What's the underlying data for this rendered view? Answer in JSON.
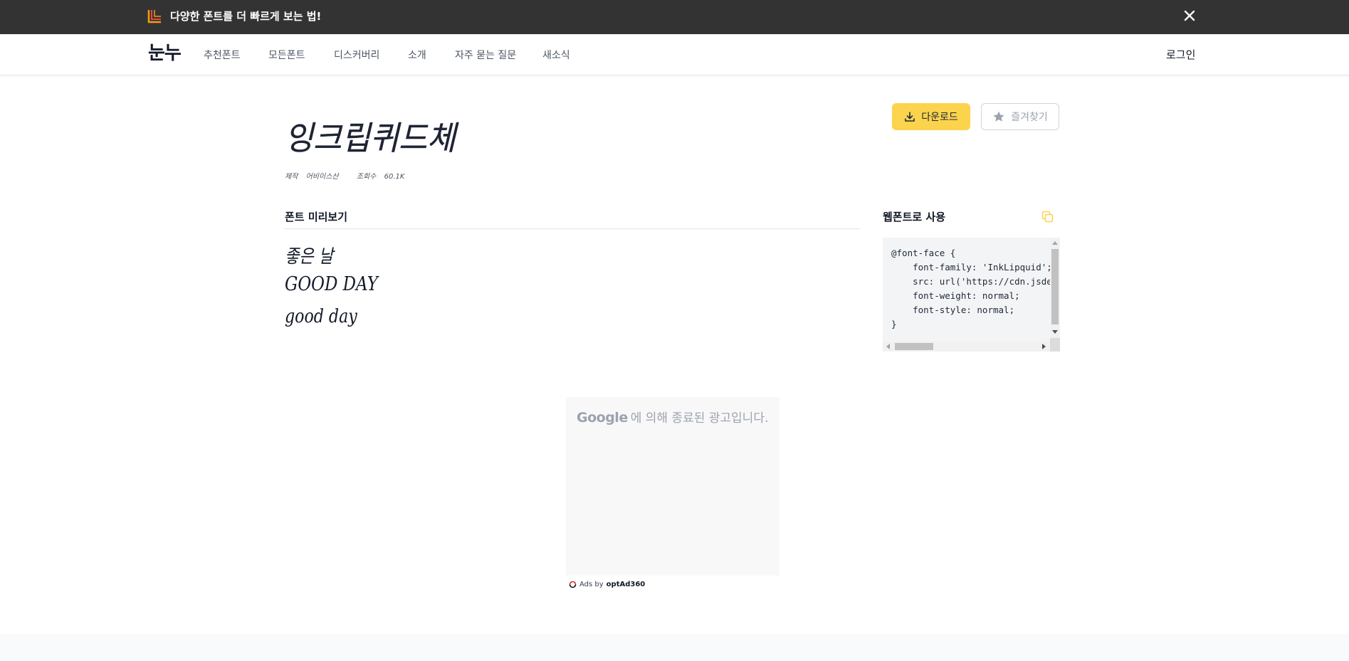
{
  "banner": {
    "text": "다양한 폰트를 더 빠르게 보는 법!"
  },
  "nav": {
    "logo": "눈누",
    "items": [
      "추천폰트",
      "모든폰트",
      "디스커버리",
      "소개",
      "자주 묻는 질문",
      "새소식"
    ],
    "login": "로그인"
  },
  "font": {
    "title": "잉크립퀴드체",
    "meta_maker_label": "제작",
    "meta_maker": "어비이스산",
    "meta_views_label": "조회수",
    "meta_views": "60.1K"
  },
  "actions": {
    "download": "다운로드",
    "favorite": "즐겨찾기"
  },
  "preview": {
    "title": "폰트 미리보기",
    "lines": [
      "좋은 날",
      "GOOD DAY",
      "good day"
    ]
  },
  "webfont": {
    "title": "웹폰트로 사용",
    "code": "@font-face {\n    font-family: 'InkLipquid';\n    src: url('https://cdn.jsdelivr.net\n    font-weight: normal;\n    font-style: normal;\n}"
  },
  "ad": {
    "google": "Google",
    "text": "에 의해 종료된 광고입니다.",
    "footer_prefix": "Ads by",
    "footer_brand": "optAd360"
  },
  "colors": {
    "banner_bg": "#333333",
    "accent_yellow": "#fcd34d"
  }
}
